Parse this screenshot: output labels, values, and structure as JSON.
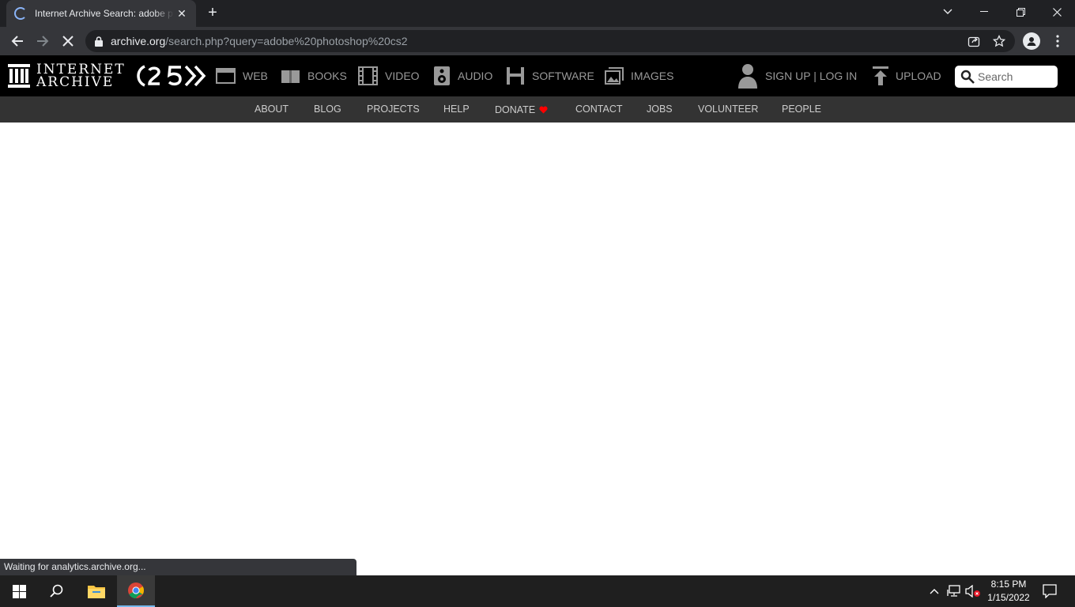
{
  "browser": {
    "tab_title": "Internet Archive Search: adobe photoshop cs2",
    "tab_close": "✕",
    "new_tab": "+",
    "url_host": "archive.org",
    "url_path": "/search.php?query=adobe%20photoshop%20cs2",
    "status_text": "Waiting for analytics.archive.org..."
  },
  "ia": {
    "logo_line1": "INTERNET",
    "logo_line2": "ARCHIVE",
    "nav": {
      "web": "WEB",
      "books": "BOOKS",
      "video": "VIDEO",
      "audio": "AUDIO",
      "software": "SOFTWARE",
      "images": "IMAGES"
    },
    "signup_login": "SIGN UP | LOG IN",
    "upload": "UPLOAD",
    "search_placeholder": "Search",
    "subnav": {
      "about": "ABOUT",
      "blog": "BLOG",
      "projects": "PROJECTS",
      "help": "HELP",
      "donate": "DONATE",
      "contact": "CONTACT",
      "jobs": "JOBS",
      "volunteer": "VOLUNTEER",
      "people": "PEOPLE"
    }
  },
  "taskbar": {
    "time": "8:15 PM",
    "date": "1/15/2022"
  },
  "colors": {
    "ia_black": "#000000",
    "ia_subnav": "#333333",
    "donate_heart": "#ff0000",
    "chrome_dark": "#202124",
    "chrome_toolbar": "#35363a"
  }
}
